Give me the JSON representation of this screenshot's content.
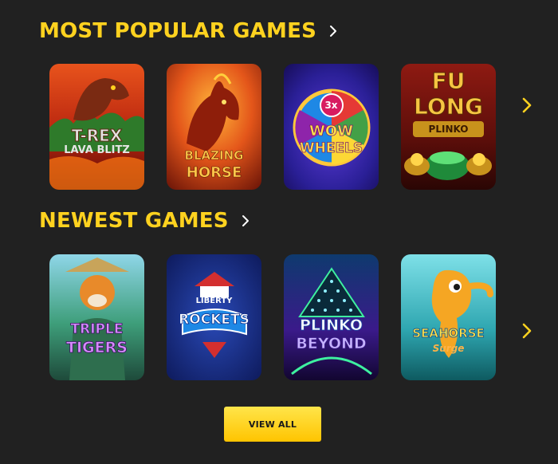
{
  "sections": [
    {
      "title": "MOST POPULAR GAMES",
      "games": [
        {
          "line1": "T-REX",
          "line2": "LAVA BLITZ"
        },
        {
          "line1": "BLAZING",
          "line2": "HORSE"
        },
        {
          "line1": "3x",
          "line2": "WOW",
          "line3": "WHEELS"
        },
        {
          "line1": "FU",
          "line2": "LONG",
          "line3": "PLINKO"
        }
      ]
    },
    {
      "title": "NEWEST GAMES",
      "games": [
        {
          "line1": "TRIPLE",
          "line2": "TIGERS"
        },
        {
          "line1": "LIBERTY",
          "line2": "ROCKETS"
        },
        {
          "line1": "PLINKO",
          "line2": "BEYOND"
        },
        {
          "line1": "SEAHORSE",
          "line2": "Surge"
        }
      ]
    }
  ],
  "view_all_label": "VIEW ALL",
  "colors": {
    "accent": "#FFD21F",
    "background": "#212121"
  },
  "icons": {
    "section_link": "chevron-right-icon",
    "carousel_next": "chevron-right-icon"
  }
}
